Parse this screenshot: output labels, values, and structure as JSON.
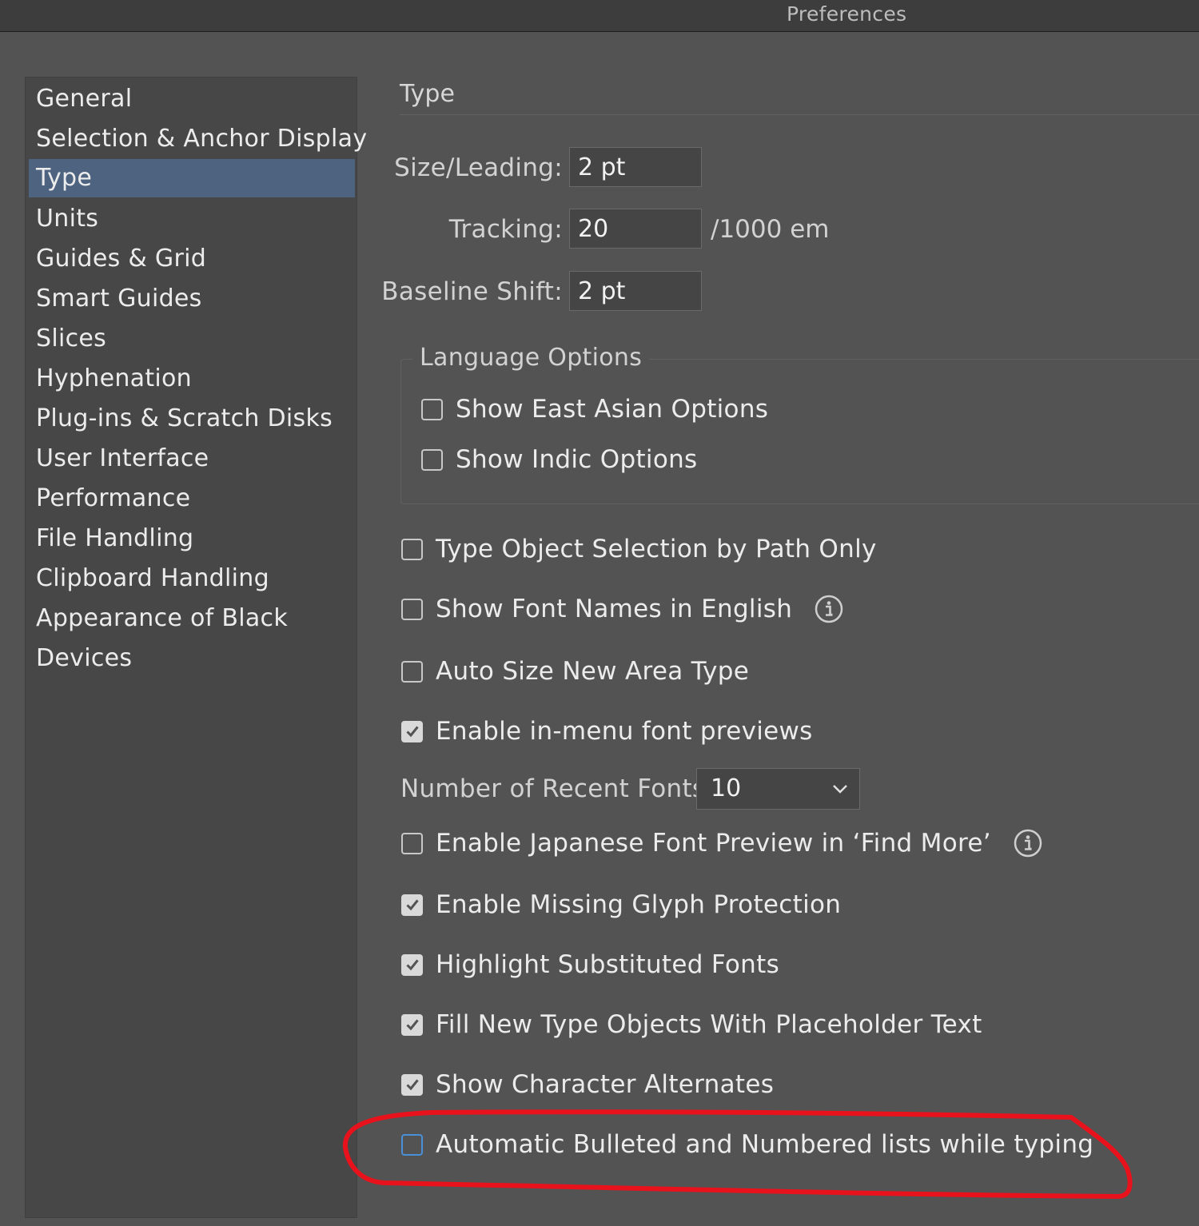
{
  "window": {
    "title": "Preferences"
  },
  "sidebar": {
    "items": [
      {
        "label": "General"
      },
      {
        "label": "Selection & Anchor Display"
      },
      {
        "label": "Type"
      },
      {
        "label": "Units"
      },
      {
        "label": "Guides & Grid"
      },
      {
        "label": "Smart Guides"
      },
      {
        "label": "Slices"
      },
      {
        "label": "Hyphenation"
      },
      {
        "label": "Plug-ins & Scratch Disks"
      },
      {
        "label": "User Interface"
      },
      {
        "label": "Performance"
      },
      {
        "label": "File Handling"
      },
      {
        "label": "Clipboard Handling"
      },
      {
        "label": "Appearance of Black"
      },
      {
        "label": "Devices"
      }
    ],
    "selected_index": 2
  },
  "main": {
    "section_title": "Type",
    "size_leading": {
      "label": "Size/Leading:",
      "value": "2 pt"
    },
    "tracking": {
      "label": "Tracking:",
      "value": "20",
      "unit": "/1000 em"
    },
    "baseline_shift": {
      "label": "Baseline Shift:",
      "value": "2 pt"
    },
    "language_options": {
      "title": "Language Options",
      "options": [
        {
          "label": "Show East Asian Options",
          "checked": false
        },
        {
          "label": "Show Indic Options",
          "checked": false
        }
      ]
    },
    "options": [
      {
        "label": "Type Object Selection by Path Only",
        "checked": false
      },
      {
        "label": "Show Font Names in English",
        "checked": false,
        "info": true
      },
      {
        "label": "Auto Size New Area Type",
        "checked": false
      },
      {
        "label": "Enable in-menu font previews",
        "checked": true
      }
    ],
    "recent_fonts": {
      "label": "Number of Recent Fonts:",
      "value": "10"
    },
    "options2": [
      {
        "label": "Enable Japanese Font Preview in ‘Find More’",
        "checked": false,
        "info": true
      },
      {
        "label": "Enable Missing Glyph Protection",
        "checked": true
      },
      {
        "label": "Highlight Substituted Fonts",
        "checked": true
      },
      {
        "label": "Fill New Type Objects With Placeholder Text",
        "checked": true
      },
      {
        "label": "Show Character Alternates",
        "checked": true
      },
      {
        "label": "Automatic Bulleted and Numbered lists while typing",
        "checked": false,
        "focused": true
      }
    ]
  },
  "annotation": {
    "color": "#e8121c",
    "target": "Automatic Bulleted and Numbered lists while typing"
  }
}
